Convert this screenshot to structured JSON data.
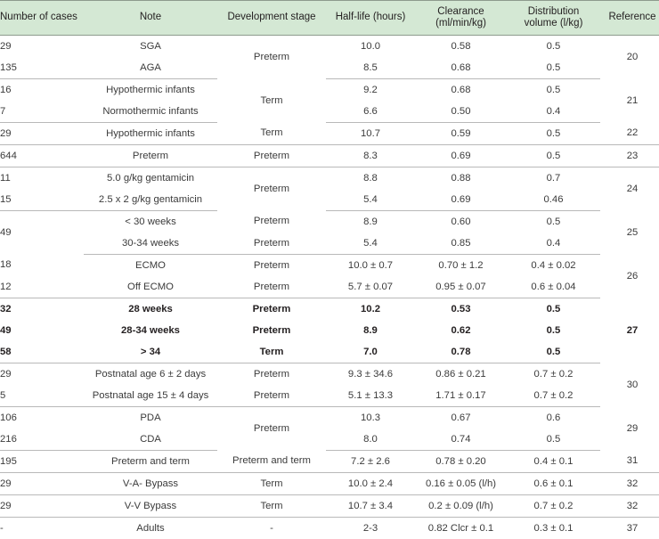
{
  "table": {
    "columns": [
      {
        "key": "cases",
        "label": "Number of cases",
        "align": "left"
      },
      {
        "key": "note",
        "label": "Note",
        "align": "center"
      },
      {
        "key": "stage",
        "label": "Development stage",
        "align": "center"
      },
      {
        "key": "half_life",
        "label": "Half-life (hours)",
        "align": "center"
      },
      {
        "key": "clearance",
        "label": "Clearance",
        "label_line2": "(ml/min/kg)",
        "align": "center"
      },
      {
        "key": "volume",
        "label": "Distribution",
        "label_line2": "volume (l/kg)",
        "align": "center"
      },
      {
        "key": "reference",
        "label": "Reference",
        "align": "center"
      }
    ],
    "header_bg": "#d4e8d4",
    "rule_color": "#8d9b8d",
    "row_rule_color": "#b9b9b9",
    "rows": [
      {
        "cases": "29",
        "note": "SGA",
        "stage": "Preterm",
        "stage_span": 2,
        "half_life": "10.0",
        "clearance": "0.58",
        "volume": "0.5",
        "reference": "20",
        "reference_span": 2,
        "bold": false,
        "rule": false
      },
      {
        "cases": "135",
        "note": "AGA",
        "stage": "",
        "stage_span": 0,
        "half_life": "8.5",
        "clearance": "0.68",
        "volume": "0.5",
        "reference": "",
        "reference_span": 0,
        "bold": false,
        "rule": true
      },
      {
        "cases": "16",
        "note": "Hypothermic infants",
        "stage": "Term",
        "stage_span": 2,
        "half_life": "9.2",
        "clearance": "0.68",
        "volume": "0.5",
        "reference": "21",
        "reference_span": 2,
        "bold": false,
        "rule": false
      },
      {
        "cases": "7",
        "note": "Normothermic infants",
        "stage": "",
        "stage_span": 0,
        "half_life": "6.6",
        "clearance": "0.50",
        "volume": "0.4",
        "reference": "",
        "reference_span": 0,
        "bold": false,
        "rule": true
      },
      {
        "cases": "29",
        "note": "Hypothermic infants",
        "stage": "Term",
        "stage_span": 1,
        "half_life": "10.7",
        "clearance": "0.59",
        "volume": "0.5",
        "reference": "22",
        "reference_span": 1,
        "bold": false,
        "rule": true
      },
      {
        "cases": "644",
        "note": "Preterm",
        "stage": "Preterm",
        "stage_span": 1,
        "half_life": "8.3",
        "clearance": "0.69",
        "volume": "0.5",
        "reference": "23",
        "reference_span": 1,
        "bold": false,
        "rule": true
      },
      {
        "cases": "11",
        "note": "5.0 g/kg gentamicin",
        "stage": "Preterm",
        "stage_span": 2,
        "half_life": "8.8",
        "clearance": "0.88",
        "volume": "0.7",
        "reference": "24",
        "reference_span": 2,
        "bold": false,
        "rule": false
      },
      {
        "cases": "15",
        "note": "2.5 x 2 g/kg gentamicin",
        "stage": "",
        "stage_span": 0,
        "half_life": "5.4",
        "clearance": "0.69",
        "volume": "0.46",
        "reference": "",
        "reference_span": 0,
        "bold": false,
        "rule": true
      },
      {
        "cases": "49",
        "note": "< 30 weeks",
        "stage": "Preterm",
        "stage_span": 1,
        "half_life": "8.9",
        "clearance": "0.60",
        "volume": "0.5",
        "reference": "25",
        "reference_span": 2,
        "bold": false,
        "rule": false,
        "cases_span": 2
      },
      {
        "cases": "",
        "note": "30-34 weeks",
        "stage": "Preterm",
        "stage_span": 1,
        "half_life": "5.4",
        "clearance": "0.85",
        "volume": "0.4",
        "reference": "",
        "reference_span": 0,
        "bold": false,
        "rule": true,
        "cases_span": 0
      },
      {
        "cases": "18",
        "note": "ECMO",
        "stage": "Preterm",
        "stage_span": 1,
        "half_life": "10.0 ± 0.7",
        "clearance": "0.70 ± 1.2",
        "volume": "0.4 ± 0.02",
        "reference": "26",
        "reference_span": 2,
        "bold": false,
        "rule": false
      },
      {
        "cases": "12",
        "note": "Off ECMO",
        "stage": "Preterm",
        "stage_span": 1,
        "half_life": "5.7 ± 0.07",
        "clearance": "0.95 ± 0.07",
        "volume": "0.6 ± 0.04",
        "reference": "",
        "reference_span": 0,
        "bold": false,
        "rule": true
      },
      {
        "cases": "32",
        "note": "28 weeks",
        "stage": "Preterm",
        "stage_span": 1,
        "half_life": "10.2",
        "clearance": "0.53",
        "volume": "0.5",
        "reference": "27",
        "reference_span": 3,
        "bold": true,
        "rule": false
      },
      {
        "cases": "49",
        "note": "28-34 weeks",
        "stage": "Preterm",
        "stage_span": 1,
        "half_life": "8.9",
        "clearance": "0.62",
        "volume": "0.5",
        "reference": "",
        "reference_span": 0,
        "bold": true,
        "rule": false
      },
      {
        "cases": "58",
        "note": "> 34",
        "stage": "Term",
        "stage_span": 1,
        "half_life": "7.0",
        "clearance": "0.78",
        "volume": "0.5",
        "reference": "",
        "reference_span": 0,
        "bold": true,
        "rule": true
      },
      {
        "cases": "29",
        "note": "Postnatal age 6 ± 2 days",
        "stage": "Preterm",
        "stage_span": 1,
        "half_life": "9.3 ± 34.6",
        "clearance": "0.86 ± 0.21",
        "volume": "0.7 ± 0.2",
        "reference": "30",
        "reference_span": 2,
        "bold": false,
        "rule": false
      },
      {
        "cases": "5",
        "note": "Postnatal age 15 ± 4 days",
        "stage": "Preterm",
        "stage_span": 1,
        "half_life": "5.1 ± 13.3",
        "clearance": "1.71 ± 0.17",
        "volume": "0.7 ± 0.2",
        "reference": "",
        "reference_span": 0,
        "bold": false,
        "rule": true
      },
      {
        "cases": "106",
        "note": "PDA",
        "stage": "Preterm",
        "stage_span": 2,
        "half_life": "10.3",
        "clearance": "0.67",
        "volume": "0.6",
        "reference": "29",
        "reference_span": 2,
        "bold": false,
        "rule": false
      },
      {
        "cases": "216",
        "note": "CDA",
        "stage": "",
        "stage_span": 0,
        "half_life": "8.0",
        "clearance": "0.74",
        "volume": "0.5",
        "reference": "",
        "reference_span": 0,
        "bold": false,
        "rule": true
      },
      {
        "cases": "195",
        "note": "Preterm and term",
        "stage": "Preterm and term",
        "stage_span": 1,
        "half_life": "7.2 ± 2.6",
        "clearance": "0.78 ± 0.20",
        "volume": "0.4 ± 0.1",
        "reference": "31",
        "reference_span": 1,
        "bold": false,
        "rule": true
      },
      {
        "cases": "29",
        "note": "V-A- Bypass",
        "stage": "Term",
        "stage_span": 1,
        "half_life": "10.0 ± 2.4",
        "clearance": "0.16 ± 0.05 (l/h)",
        "volume": "0.6 ± 0.1",
        "reference": "32",
        "reference_span": 1,
        "bold": false,
        "rule": true
      },
      {
        "cases": "29",
        "note": "V-V Bypass",
        "stage": "Term",
        "stage_span": 1,
        "half_life": "10.7 ± 3.4",
        "clearance": "0.2 ± 0.09 (l/h)",
        "volume": "0.7 ± 0.2",
        "reference": "32",
        "reference_span": 1,
        "bold": false,
        "rule": true
      },
      {
        "cases": "-",
        "note": "Adults",
        "stage": "-",
        "stage_span": 1,
        "half_life": "2-3",
        "clearance": "0.82 Clcr ± 0.1",
        "volume": "0.3 ± 0.1",
        "reference": "37",
        "reference_span": 1,
        "bold": false,
        "rule": false
      }
    ]
  }
}
